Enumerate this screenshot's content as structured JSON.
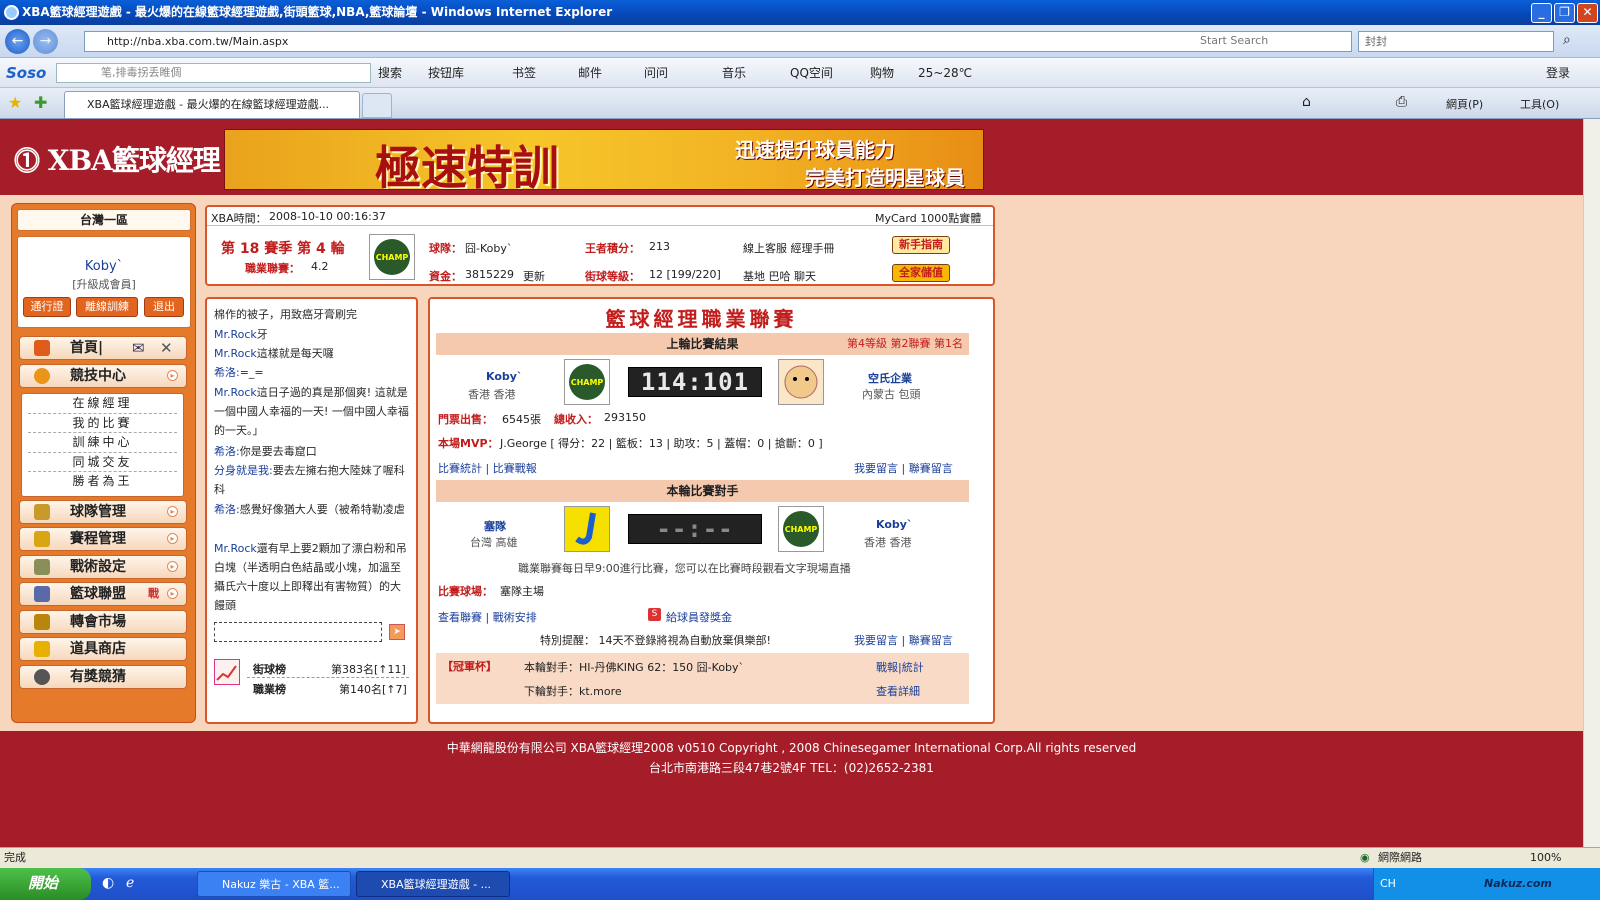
{
  "window": {
    "title": "XBA籃球經理遊戲 - 最火爆的在線籃球經理遊戲,街頭籃球,NBA,籃球論壇 - Windows Internet Explorer"
  },
  "addressbar": {
    "url": "http://nba.xba.com.tw/Main.aspx",
    "search_hint": "Start Search",
    "search_value": "封封"
  },
  "toolbar2": {
    "soso": "Soso",
    "soso_input": "笔,排毒拐丢睢倜",
    "search": "搜索",
    "items": [
      "按钮库",
      "书签",
      "邮件",
      "问问",
      "音乐",
      "QQ空间",
      "购物",
      "25~28℃"
    ],
    "login": "登录"
  },
  "tab": {
    "label": "XBA籃球經理遊戲 - 最火爆的在線籃球經理遊戲..."
  },
  "cmdbar": {
    "page": "網頁(P)",
    "tools": "工具(O)"
  },
  "header": {
    "logo": "XBA籃球經理",
    "banner_main": "極速特訓",
    "banner_sub1": "迅速提升球員能力",
    "banner_sub2": "完美打造明星球員"
  },
  "left": {
    "region": "台灣一區",
    "username": "Koby`",
    "member": "[升級成會員]",
    "buttons": [
      "通行證",
      "離線訓練",
      "退出"
    ],
    "menu_home": "首頁|",
    "menu": [
      "競技中心",
      "球隊管理",
      "賽程管理",
      "戰術設定",
      "籃球聯盟",
      "轉會市場",
      "道具商店",
      "有獎競猜"
    ],
    "menu_side_label": "戰",
    "submenu": [
      "在線經理",
      "我的比賽",
      "訓練中心",
      "同城交友",
      "勝者為王"
    ]
  },
  "info": {
    "time_label": "XBA時間：",
    "time": "2008-10-10 00:16:37",
    "mycard": "MyCard 1000點實體",
    "season": "第 18 賽季 第 4 輪",
    "rating_label": "職業聯賽：",
    "rating": "4.2",
    "team_label": "球隊：",
    "team": "囧-Koby`",
    "king_label": "王者積分：",
    "king": "213",
    "links1": "線上客服  經理手冊",
    "money_label": "資金：",
    "money": "3815229",
    "update": "更新",
    "street_label": "街球等級：",
    "street": "12 [199/220]",
    "links2": "基地  巴哈  聊天",
    "badge1": "新手指南",
    "badge2": "全家儲值"
  },
  "chat": {
    "messages": [
      {
        "name": "",
        "text": "棉作的被子，用致癌牙膏刷完"
      },
      {
        "name": "Mr.Rock",
        "text": "牙"
      },
      {
        "name": "Mr.Rock",
        "text": "這樣就是每天囉"
      },
      {
        "name": "希洛:",
        "text": "=_="
      },
      {
        "name": "Mr.Rock",
        "text": "這日子過的真是那個爽! 這就是一個中國人幸福的一天! 一個中國人幸福的一天。」"
      },
      {
        "name": "希洛:",
        "text": "你是要去毒窟口"
      },
      {
        "name": "分身就是我:",
        "text": "要去左擁右抱大陸妹了喔科科"
      },
      {
        "name": "希洛:",
        "text": "感覺好像猶大人要（被希特勒凌虐"
      },
      {
        "name": "Mr.Rock",
        "text": "還有早上要2顆加了漂白粉和吊白塊（半透明白色結晶或小塊，加溫至攝氏六十度以上即釋出有害物質）的大饅頭"
      }
    ],
    "rank1_label": "街球榜",
    "rank1_value": "第383名[↑11]",
    "rank2_label": "職業榜",
    "rank2_value": "第140名[↑7]"
  },
  "league": {
    "title": "籃球經理職業聯賽",
    "last_result": "上輪比賽結果",
    "last_info": "第4等級  第2聯賽  第1名",
    "home_team": "Koby`",
    "home_loc": "香港  香港",
    "score": "114:101",
    "away_team": "空氏企業",
    "away_loc": "內蒙古  包頭",
    "ticket_label": "門票出售：",
    "ticket": "6545張",
    "income_label": "總收入：",
    "income": "293150",
    "mvp_label": "本場MVP：",
    "mvp": "J.George [ 得分：22 | 籃板：13 | 助攻：5 | 蓋帽：0 | 搶斷：0 ]",
    "link_stats": "比賽統計 | 比賽戰報",
    "link_msg": "我要留言 | 聯賽留言",
    "this_round": "本輪比賽對手",
    "opp_team": "塞隊",
    "opp_loc": "台灣  高雄",
    "pending_score": "--:--",
    "me_team": "Koby`",
    "me_loc": "香港  香港",
    "schedule_note": "職業聯賽每日早9:00進行比賽，您可以在比賽時段觀看文字現場直播",
    "arena_label": "比賽球場：",
    "arena": "塞隊主場",
    "link_league": "查看聯賽 | 戰術安排",
    "bonus": "給球員發獎金",
    "notice": "特別提醒：  14天不登錄將視為自動放棄俱樂部!",
    "link_msg2": "我要留言 | 聯賽留言",
    "cup_label": "【冠軍杯】",
    "cup_this": "本輪對手：HI-丹佛KING 62：150 囧-Koby`",
    "cup_next": "下輪對手：kt.more",
    "cup_link1": "戰報|統計",
    "cup_link2": "查看詳細"
  },
  "footer": {
    "line1": "中華網龍股份有限公司  XBA籃球經理2008 v0510     Copyright , 2008 Chinesegamer International Corp.All rights reserved",
    "line2": "台北市南港路三段47巷2號4F TEL：(02)2652-2381"
  },
  "status": {
    "text": "完成",
    "zone": "網際網路",
    "zoom": "100%"
  },
  "taskbar": {
    "start": "開始",
    "tasks": [
      "Nakuz 樂古 - XBA 籃...",
      "XBA籃球經理遊戲 - ..."
    ],
    "tray": "CH",
    "watermark": "Nakuz.com"
  }
}
